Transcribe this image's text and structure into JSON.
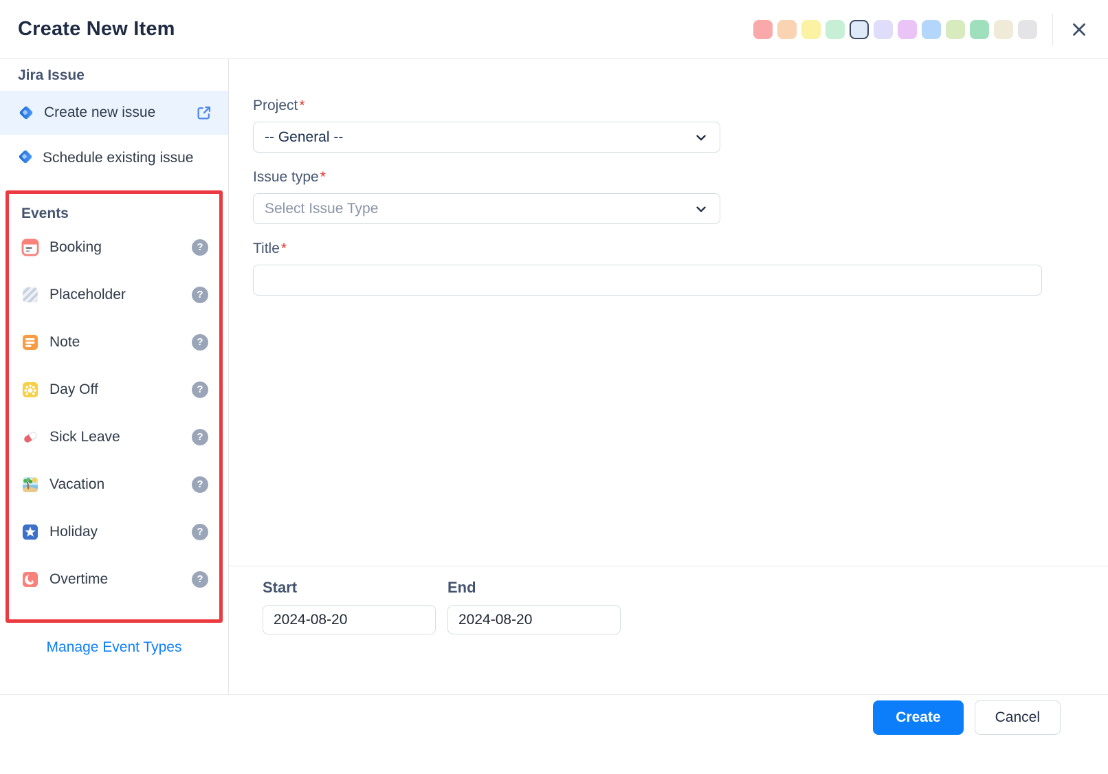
{
  "header": {
    "title": "Create New Item",
    "swatches": [
      {
        "name": "color-pink",
        "color": "#F9A9AA",
        "selected": false
      },
      {
        "name": "color-peach",
        "color": "#FAD4B2",
        "selected": false
      },
      {
        "name": "color-yellow",
        "color": "#FBF2A4",
        "selected": false
      },
      {
        "name": "color-mint",
        "color": "#C6EFD6",
        "selected": false
      },
      {
        "name": "color-lightblue",
        "color": "#DEE9F9",
        "selected": true
      },
      {
        "name": "color-lavender",
        "color": "#DFDDFA",
        "selected": false
      },
      {
        "name": "color-orchid",
        "color": "#EAC4F7",
        "selected": false
      },
      {
        "name": "color-blue",
        "color": "#B4D6FB",
        "selected": false
      },
      {
        "name": "color-lightgreen",
        "color": "#D8EBBF",
        "selected": false
      },
      {
        "name": "color-green",
        "color": "#A0DFBC",
        "selected": false
      },
      {
        "name": "color-beige",
        "color": "#F0EBD9",
        "selected": false
      },
      {
        "name": "color-gray",
        "color": "#E4E4E6",
        "selected": false
      }
    ]
  },
  "sidebar": {
    "jira_section": {
      "title": "Jira Issue",
      "items": [
        {
          "label": "Create new issue",
          "icon": "jira-icon",
          "trailing_icon": "external-link-icon",
          "selected": true
        },
        {
          "label": "Schedule existing issue",
          "icon": "jira-icon",
          "selected": false
        }
      ]
    },
    "events_section": {
      "title": "Events",
      "highlight_color": "#EB3B40",
      "help_glyph": "?",
      "items": [
        {
          "label": "Booking",
          "icon": "booking-calendar-icon"
        },
        {
          "label": "Placeholder",
          "icon": "placeholder-stripes-icon"
        },
        {
          "label": "Note",
          "icon": "note-icon"
        },
        {
          "label": "Day Off",
          "icon": "day-off-sun-icon"
        },
        {
          "label": "Sick Leave",
          "icon": "pill-icon"
        },
        {
          "label": "Vacation",
          "icon": "beach-palm-icon"
        },
        {
          "label": "Holiday",
          "icon": "star-icon"
        },
        {
          "label": "Overtime",
          "icon": "crescent-moon-icon"
        }
      ]
    },
    "manage_link": "Manage Event Types"
  },
  "form": {
    "project": {
      "label": "Project",
      "required": "*",
      "value": "-- General --"
    },
    "issue_type": {
      "label": "Issue type",
      "required": "*",
      "placeholder": "Select Issue Type"
    },
    "title_field": {
      "label": "Title",
      "required": "*",
      "value": ""
    },
    "dates": {
      "start": {
        "label": "Start",
        "value": "2024-08-20"
      },
      "end": {
        "label": "End",
        "value": "2024-08-20"
      }
    }
  },
  "footer": {
    "create_label": "Create",
    "cancel_label": "Cancel",
    "accent_color": "#0D7EF9"
  }
}
